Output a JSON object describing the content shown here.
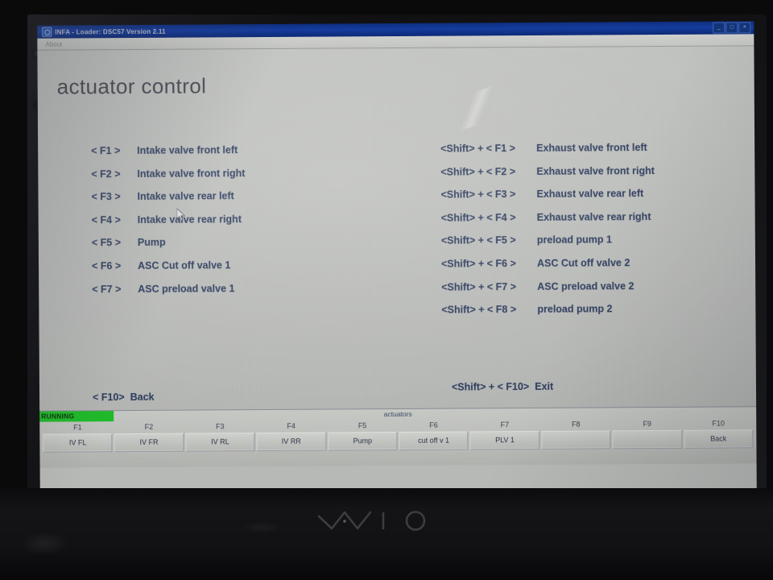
{
  "device": {
    "brand_logo": "VAIO",
    "logo_name": "vaio-logo"
  },
  "window": {
    "titlebar": {
      "icon": "app-icon",
      "title": "INFA - Loader:  DSC57 Version 2.11",
      "buttons": [
        {
          "name": "minimize-button",
          "glyph": "_"
        },
        {
          "name": "maximize-button",
          "glyph": "□"
        },
        {
          "name": "close-button",
          "glyph": "×"
        }
      ]
    },
    "menubar": {
      "items": [
        {
          "name": "menu-item-about",
          "label": "About"
        }
      ]
    }
  },
  "main": {
    "page_title": "actuator control",
    "left_column": [
      {
        "key": "< F1 >",
        "label": "Intake valve front left"
      },
      {
        "key": "< F2 >",
        "label": "Intake valve front right"
      },
      {
        "key": "< F3 >",
        "label": "Intake valve rear left"
      },
      {
        "key": "< F4 >",
        "label": "Intake valve rear right"
      },
      {
        "key": "< F5 >",
        "label": "Pump"
      },
      {
        "key": "< F6 >",
        "label": "ASC Cut off valve 1"
      },
      {
        "key": "< F7 >",
        "label": "ASC preload valve 1"
      }
    ],
    "right_column": [
      {
        "key": "<Shift> + < F1 >",
        "label": "Exhaust valve front left"
      },
      {
        "key": "<Shift> + < F2 >",
        "label": "Exhaust valve front right"
      },
      {
        "key": "<Shift> + < F3 >",
        "label": "Exhaust valve rear left"
      },
      {
        "key": "<Shift> + < F4 >",
        "label": "Exhaust valve rear right"
      },
      {
        "key": "<Shift> + < F5 >",
        "label": "preload pump 1"
      },
      {
        "key": "<Shift> + < F6 >",
        "label": "ASC Cut off valve 2"
      },
      {
        "key": "<Shift> + < F7 >",
        "label": "ASC preload valve 2"
      },
      {
        "key": "<Shift> + < F8 >",
        "label": "preload pump 2"
      }
    ],
    "footer_back": {
      "key": "< F10>",
      "label": "Back"
    },
    "footer_exit": {
      "key": "<Shift> + < F10>",
      "label": "Exit"
    },
    "cursor": {
      "name": "mouse-pointer"
    }
  },
  "statusbar": {
    "status_badge": "RUNNING",
    "status_color": "#16c221",
    "caption": "actuators",
    "fkeys": [
      {
        "key": "F1",
        "button": "IV FL"
      },
      {
        "key": "F2",
        "button": "IV FR"
      },
      {
        "key": "F3",
        "button": "IV RL"
      },
      {
        "key": "F4",
        "button": "IV RR"
      },
      {
        "key": "F5",
        "button": "Pump"
      },
      {
        "key": "F6",
        "button": "cut off v 1"
      },
      {
        "key": "F7",
        "button": "PLV 1"
      },
      {
        "key": "F8",
        "button": ""
      },
      {
        "key": "F9",
        "button": ""
      },
      {
        "key": "F10",
        "button": "Back"
      }
    ]
  },
  "colors": {
    "screen_background": "#b7b9b6",
    "text_blue": "#2e3e60",
    "titlebar_blue": "#123ca6",
    "status_green": "#16c221",
    "bezel_black": "#111114"
  }
}
